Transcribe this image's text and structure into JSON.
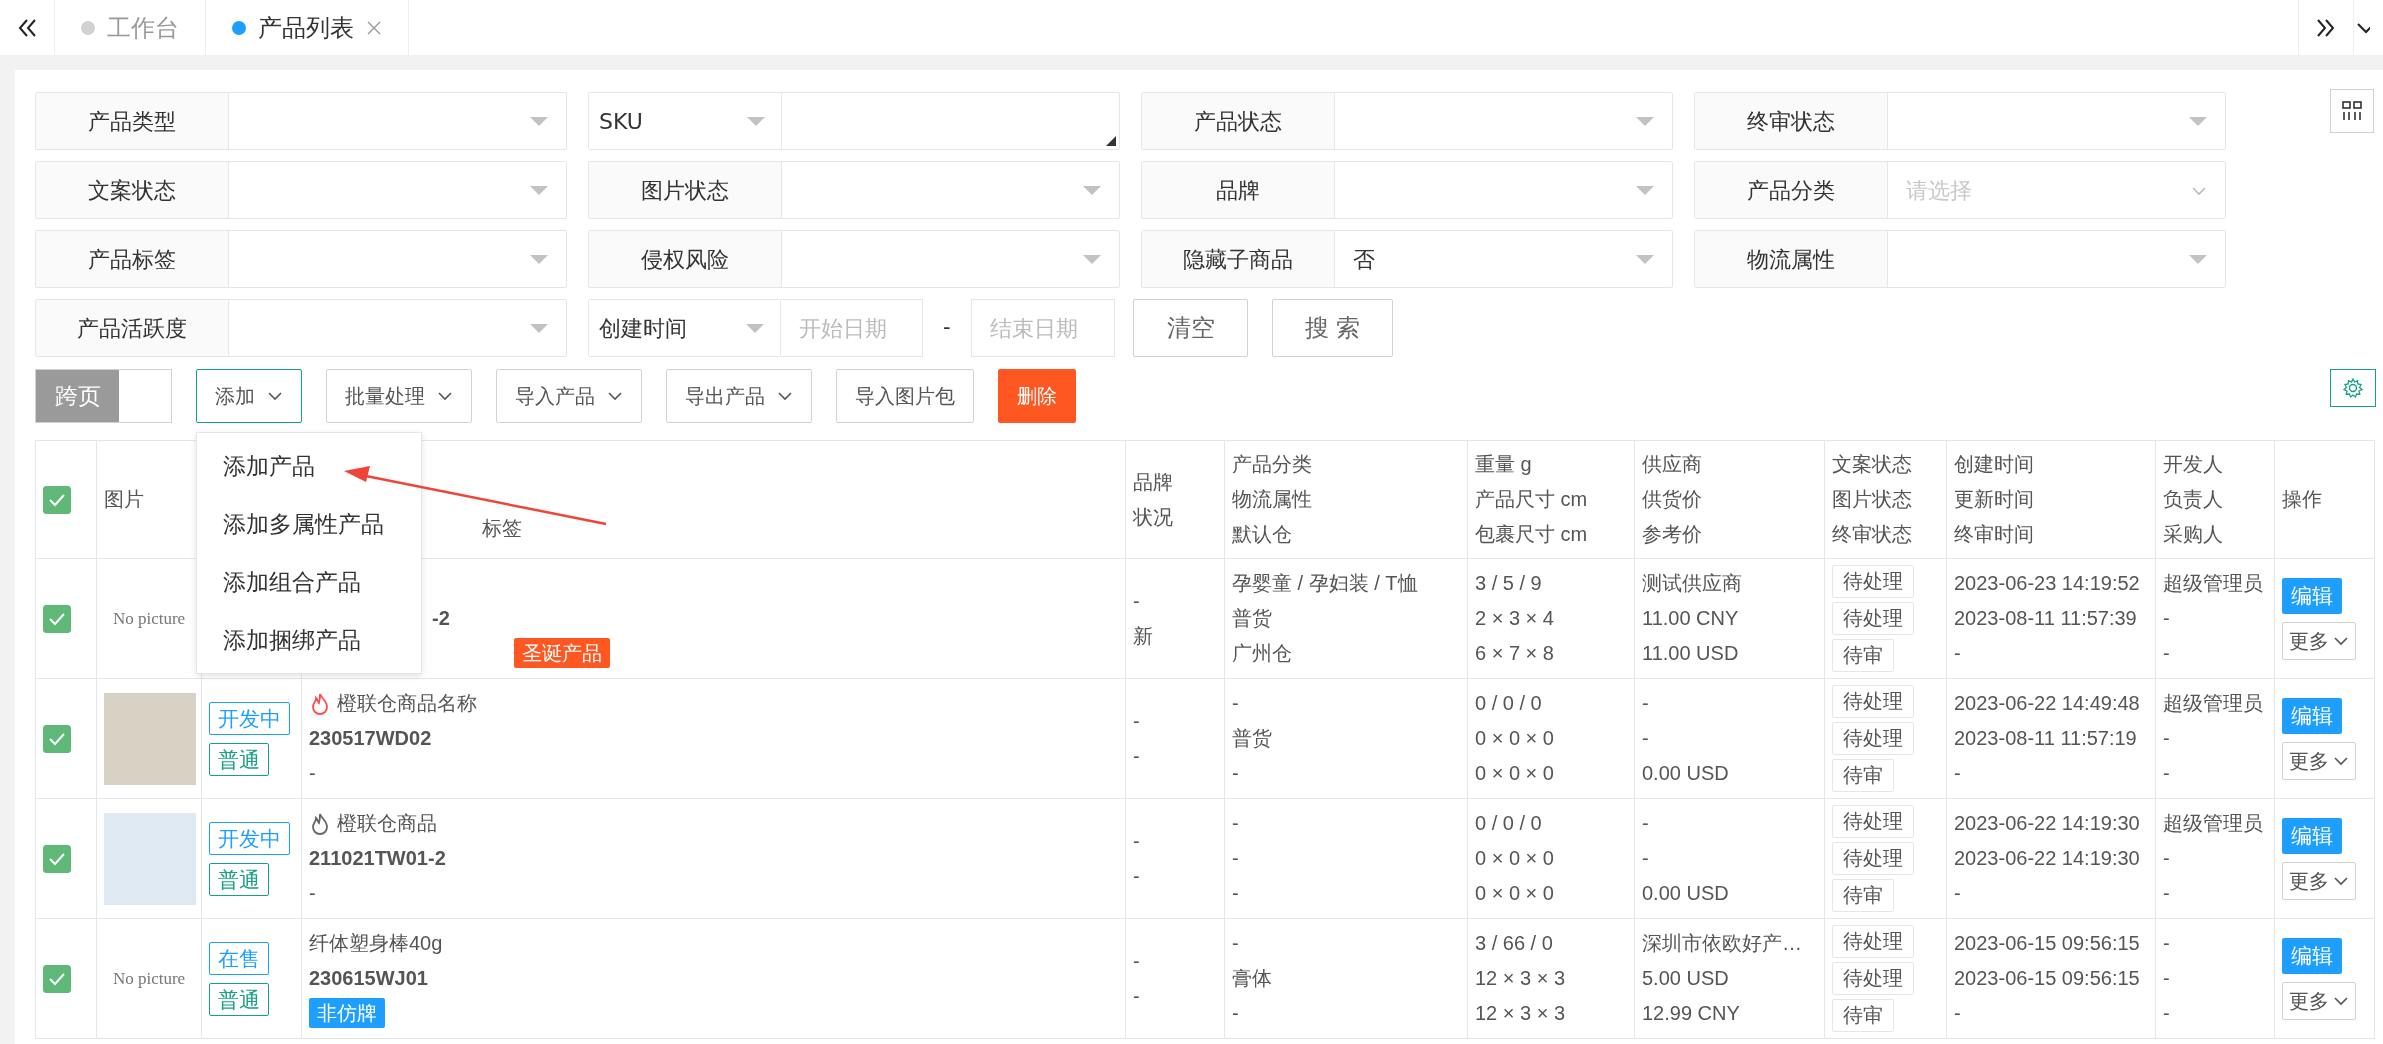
{
  "tab_bar": {
    "tabs": [
      {
        "label": "工作台",
        "selected": false,
        "closable": false
      },
      {
        "label": "产品列表",
        "selected": true,
        "closable": true
      }
    ]
  },
  "filters": [
    {
      "label": "产品类型",
      "label_dropdown": false,
      "kind": "select"
    },
    {
      "label": "SKU",
      "label_dropdown": true,
      "kind": "textarea"
    },
    {
      "label": "产品状态",
      "label_dropdown": false,
      "kind": "select"
    },
    {
      "label": "终审状态",
      "label_dropdown": false,
      "kind": "select"
    },
    {
      "label": "文案状态",
      "label_dropdown": false,
      "kind": "select"
    },
    {
      "label": "图片状态",
      "label_dropdown": false,
      "kind": "select"
    },
    {
      "label": "品牌",
      "label_dropdown": false,
      "kind": "select"
    },
    {
      "label": "产品分类",
      "label_dropdown": false,
      "kind": "cascader",
      "placeholder": "请选择"
    },
    {
      "label": "产品标签",
      "label_dropdown": false,
      "kind": "select"
    },
    {
      "label": "侵权风险",
      "label_dropdown": false,
      "kind": "select"
    },
    {
      "label": "隐藏子商品",
      "label_dropdown": false,
      "kind": "select",
      "value": "否"
    },
    {
      "label": "物流属性",
      "label_dropdown": false,
      "kind": "select"
    },
    {
      "label": "产品活跃度",
      "label_dropdown": false,
      "kind": "select"
    },
    {
      "label": "创建时间",
      "label_dropdown": true,
      "kind": "daterange",
      "start_placeholder": "开始日期",
      "separator": "-",
      "end_placeholder": "结束日期"
    }
  ],
  "filter_buttons": [
    "清空",
    "搜 索"
  ],
  "toolbar": {
    "cross_page": {
      "label": "跨页",
      "on": false
    },
    "buttons": [
      {
        "label": "添加",
        "kind": "dropdown",
        "open": true
      },
      {
        "label": "批量处理",
        "kind": "dropdown",
        "open": false
      },
      {
        "label": "导入产品",
        "kind": "dropdown",
        "open": false
      },
      {
        "label": "导出产品",
        "kind": "dropdown",
        "open": false
      },
      {
        "label": "导入图片包",
        "kind": "plain"
      },
      {
        "label": "删除",
        "kind": "danger"
      }
    ]
  },
  "add_menu": {
    "items": [
      "添加产品",
      "添加多属性产品",
      "添加组合产品",
      "添加捆绑产品"
    ]
  },
  "table": {
    "all_checked": true,
    "columns": [
      {},
      {
        "lines": [
          "图片"
        ]
      },
      {},
      {
        "lines": [
          "标签"
        ]
      },
      {
        "lines": [
          "品牌",
          "状况"
        ]
      },
      {
        "lines": [
          "产品分类",
          "物流属性",
          "默认仓"
        ]
      },
      {
        "lines": [
          "重量 g",
          "产品尺寸 cm",
          "包裹尺寸 cm"
        ]
      },
      {
        "lines": [
          "供应商",
          "供货价",
          "参考价"
        ]
      },
      {
        "lines": [
          "文案状态",
          "图片状态",
          "终审状态"
        ]
      },
      {
        "lines": [
          "创建时间",
          "更新时间",
          "终审时间"
        ]
      },
      {
        "lines": [
          "开发人",
          "负责人",
          "采购人"
        ]
      },
      {
        "lines": [
          "操作"
        ]
      }
    ],
    "rows": [
      {
        "checked": true,
        "picture": {
          "kind": "none",
          "text": "No picture"
        },
        "status_tags": [],
        "sku": "-2",
        "tags": [
          {
            "label": "圣诞产品",
            "color": "#ff5722"
          }
        ],
        "brand": [
          "-",
          "新"
        ],
        "category": [
          "孕婴童 / 孕妇装 / T恤",
          "普货",
          "广州仓"
        ],
        "size": [
          "3 / 5 / 9",
          "2 × 3 × 4",
          "6 × 7 × 8"
        ],
        "supplier": [
          "测试供应商",
          "11.00 CNY",
          "11.00 USD"
        ],
        "review": [
          "待处理",
          "待处理",
          "待审"
        ],
        "times": [
          "2023-06-23 14:19:52",
          "2023-08-11 11:57:39",
          "-"
        ],
        "people": [
          "超级管理员",
          "-",
          "-"
        ],
        "edit": "编辑",
        "more": "更多"
      },
      {
        "checked": true,
        "picture": {
          "kind": "photo"
        },
        "status_tags": [
          {
            "label": "开发中",
            "color": "#1e9fff"
          },
          {
            "label": "普通",
            "color": "#16a085"
          }
        ],
        "flame": {
          "color": "#ff4d4f"
        },
        "name": "橙联仓商品名称",
        "sku": "230517WD02",
        "remark": "-",
        "tags": [],
        "brand": [
          "-",
          "-"
        ],
        "category": [
          "-",
          "普货",
          "-"
        ],
        "size": [
          "0 / 0 / 0",
          "0 × 0 × 0",
          "0 × 0 × 0"
        ],
        "supplier": [
          "-",
          "-",
          "0.00 USD"
        ],
        "review": [
          "待处理",
          "待处理",
          "待审"
        ],
        "times": [
          "2023-06-22 14:49:48",
          "2023-08-11 11:57:19",
          "-"
        ],
        "people": [
          "超级管理员",
          "-",
          "-"
        ],
        "edit": "编辑",
        "more": "更多"
      },
      {
        "checked": true,
        "picture": {
          "kind": "photo"
        },
        "status_tags": [
          {
            "label": "开发中",
            "color": "#1e9fff"
          },
          {
            "label": "普通",
            "color": "#16a085"
          }
        ],
        "flame": {
          "color": "#666666"
        },
        "name": "橙联仓商品",
        "sku": "211021TW01-2",
        "remark": "-",
        "tags": [],
        "brand": [
          "-",
          "-"
        ],
        "category": [
          "-",
          "-",
          "-"
        ],
        "size": [
          "0 / 0 / 0",
          "0 × 0 × 0",
          "0 × 0 × 0"
        ],
        "supplier": [
          "-",
          "-",
          "0.00 USD"
        ],
        "review": [
          "待处理",
          "待处理",
          "待审"
        ],
        "times": [
          "2023-06-22 14:19:30",
          "2023-06-22 14:19:30",
          "-"
        ],
        "people": [
          "超级管理员",
          "-",
          "-"
        ],
        "edit": "编辑",
        "more": "更多"
      },
      {
        "checked": true,
        "picture": {
          "kind": "none",
          "text": "No picture"
        },
        "status_tags": [
          {
            "label": "在售",
            "color": "#1e9fff"
          },
          {
            "label": "普通",
            "color": "#16a085"
          }
        ],
        "name": "纤体塑身棒40g",
        "sku": "230615WJ01",
        "tags": [
          {
            "label": "非仿牌",
            "color": "#1e9fff"
          }
        ],
        "brand": [
          "-",
          "-"
        ],
        "category": [
          "-",
          "膏体",
          "-"
        ],
        "size": [
          "3 / 66 / 0",
          "12 × 3 × 3",
          "12 × 3 × 3"
        ],
        "supplier": [
          "深圳市依欧好产…",
          "5.00 USD",
          "12.99 CNY"
        ],
        "review": [
          "待处理",
          "待处理",
          "待审"
        ],
        "times": [
          "2023-06-15 09:56:15",
          "2023-06-15 09:56:15",
          "-"
        ],
        "people": [
          "-",
          "-",
          "-"
        ],
        "edit": "编辑",
        "more": "更多"
      }
    ]
  }
}
